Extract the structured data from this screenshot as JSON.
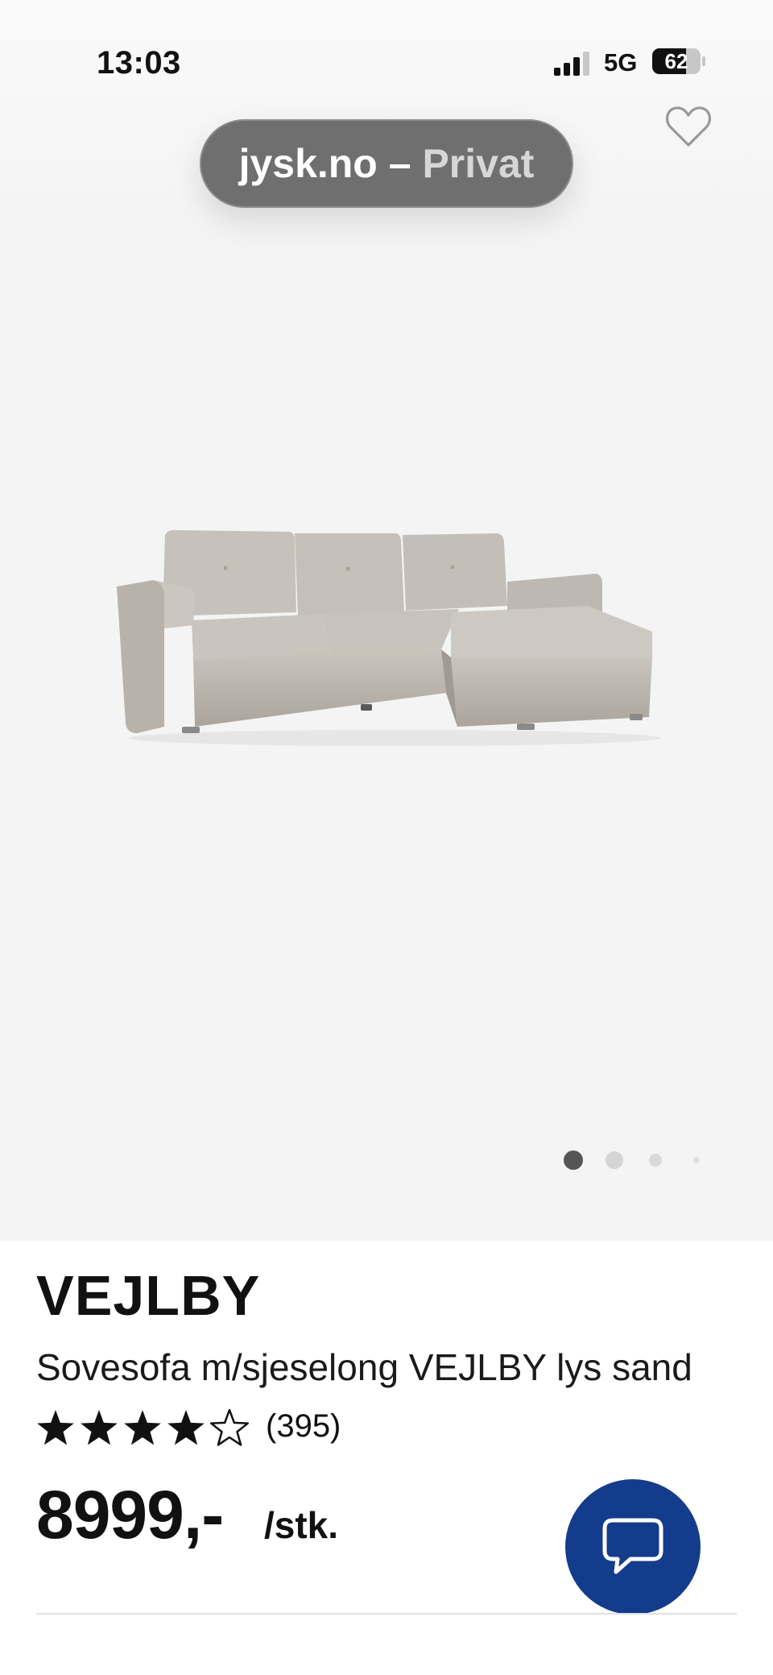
{
  "status_bar": {
    "time": "13:03",
    "network": "5G",
    "battery": "62"
  },
  "browser": {
    "domain": "jysk.no",
    "separator": " – ",
    "mode": "Privat"
  },
  "gallery": {
    "image": "sofa-image",
    "image_count": 4,
    "active_index": 0
  },
  "product": {
    "brand": "VEJLBY",
    "name": "Sovesofa m/sjeselong VEJLBY lys sand",
    "rating": 4,
    "rating_max": 5,
    "review_count": "(395)",
    "price": "8999,-",
    "unit": "/stk."
  },
  "icons": {
    "favorite": "heart-icon",
    "chat": "chat-bubble-icon"
  },
  "colors": {
    "chat_button": "#143c8c",
    "pill_background": "#6f6f6f"
  }
}
